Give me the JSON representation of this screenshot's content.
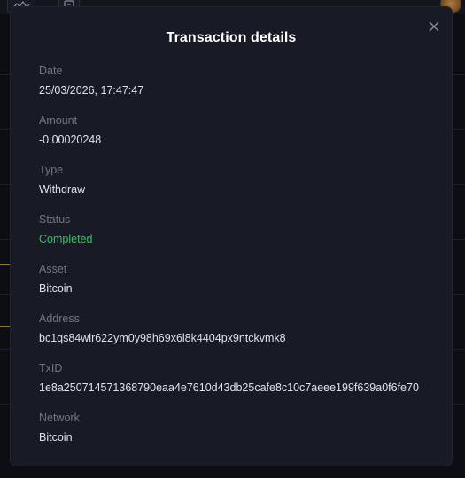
{
  "modal": {
    "title": "Transaction details",
    "fields": [
      {
        "label": "Date",
        "value": "25/03/2026, 17:47:47"
      },
      {
        "label": "Amount",
        "value": "-0.00020248"
      },
      {
        "label": "Type",
        "value": "Withdraw"
      },
      {
        "label": "Status",
        "value": "Completed"
      },
      {
        "label": "Asset",
        "value": "Bitcoin"
      },
      {
        "label": "Address",
        "value": "bc1qs84wlr622ym0y98h69x6l8k4404px9ntckvmk8"
      },
      {
        "label": "TxID",
        "value": "1e8a250714571368790eaa4e7610d43db25cafe8c10c7aeee199f639a0f6fe70"
      },
      {
        "label": "Network",
        "value": "Bitcoin"
      }
    ]
  },
  "icons": {
    "close": "close-icon",
    "background_chart": "activity-chart-icon",
    "background_message": "message-icon",
    "background_avatar": "avatar"
  },
  "colors": {
    "modal_background": "#181b26",
    "label": "#6f7689",
    "value": "#dfe2ea",
    "status_completed": "#36c25a",
    "title": "#ffffff"
  }
}
